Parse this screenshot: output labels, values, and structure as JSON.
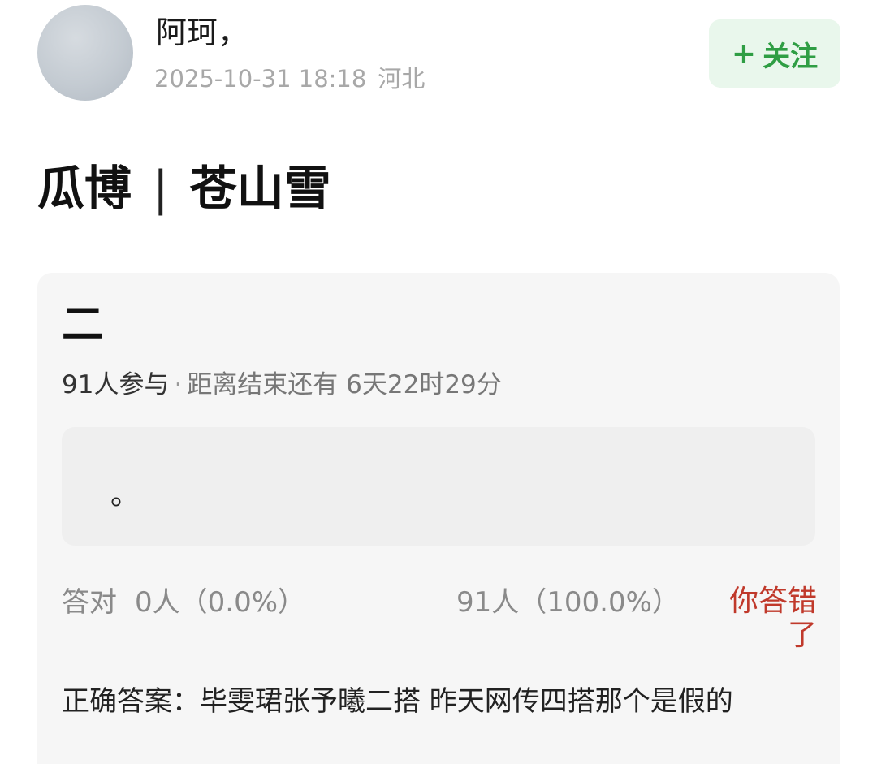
{
  "post": {
    "username": "阿珂，",
    "datetime": "2025-10-31 18:18",
    "location": "河北",
    "follow_label": "关注",
    "follow_plus": "+",
    "title_left": "瓜博",
    "title_sep": "|",
    "title_right": "苍山雪"
  },
  "quiz": {
    "question": "二",
    "participants": "91人参与",
    "separator": "·",
    "remaining": "距离结束还有 6天22时29分",
    "option_text": "。",
    "correct_label": "答对",
    "correct_count": "0人（0.0%）",
    "other_count": "91人（100.0%）",
    "wrong_text": "你答错了",
    "answer_text": "正确答案：毕雯珺张予曦二搭 昨天网传四搭那个是假的"
  },
  "colors": {
    "follow_bg": "#e9f7ec",
    "follow_text": "#2f9e44",
    "wrong_text": "#c0392b",
    "card_bg": "#f6f6f6"
  }
}
